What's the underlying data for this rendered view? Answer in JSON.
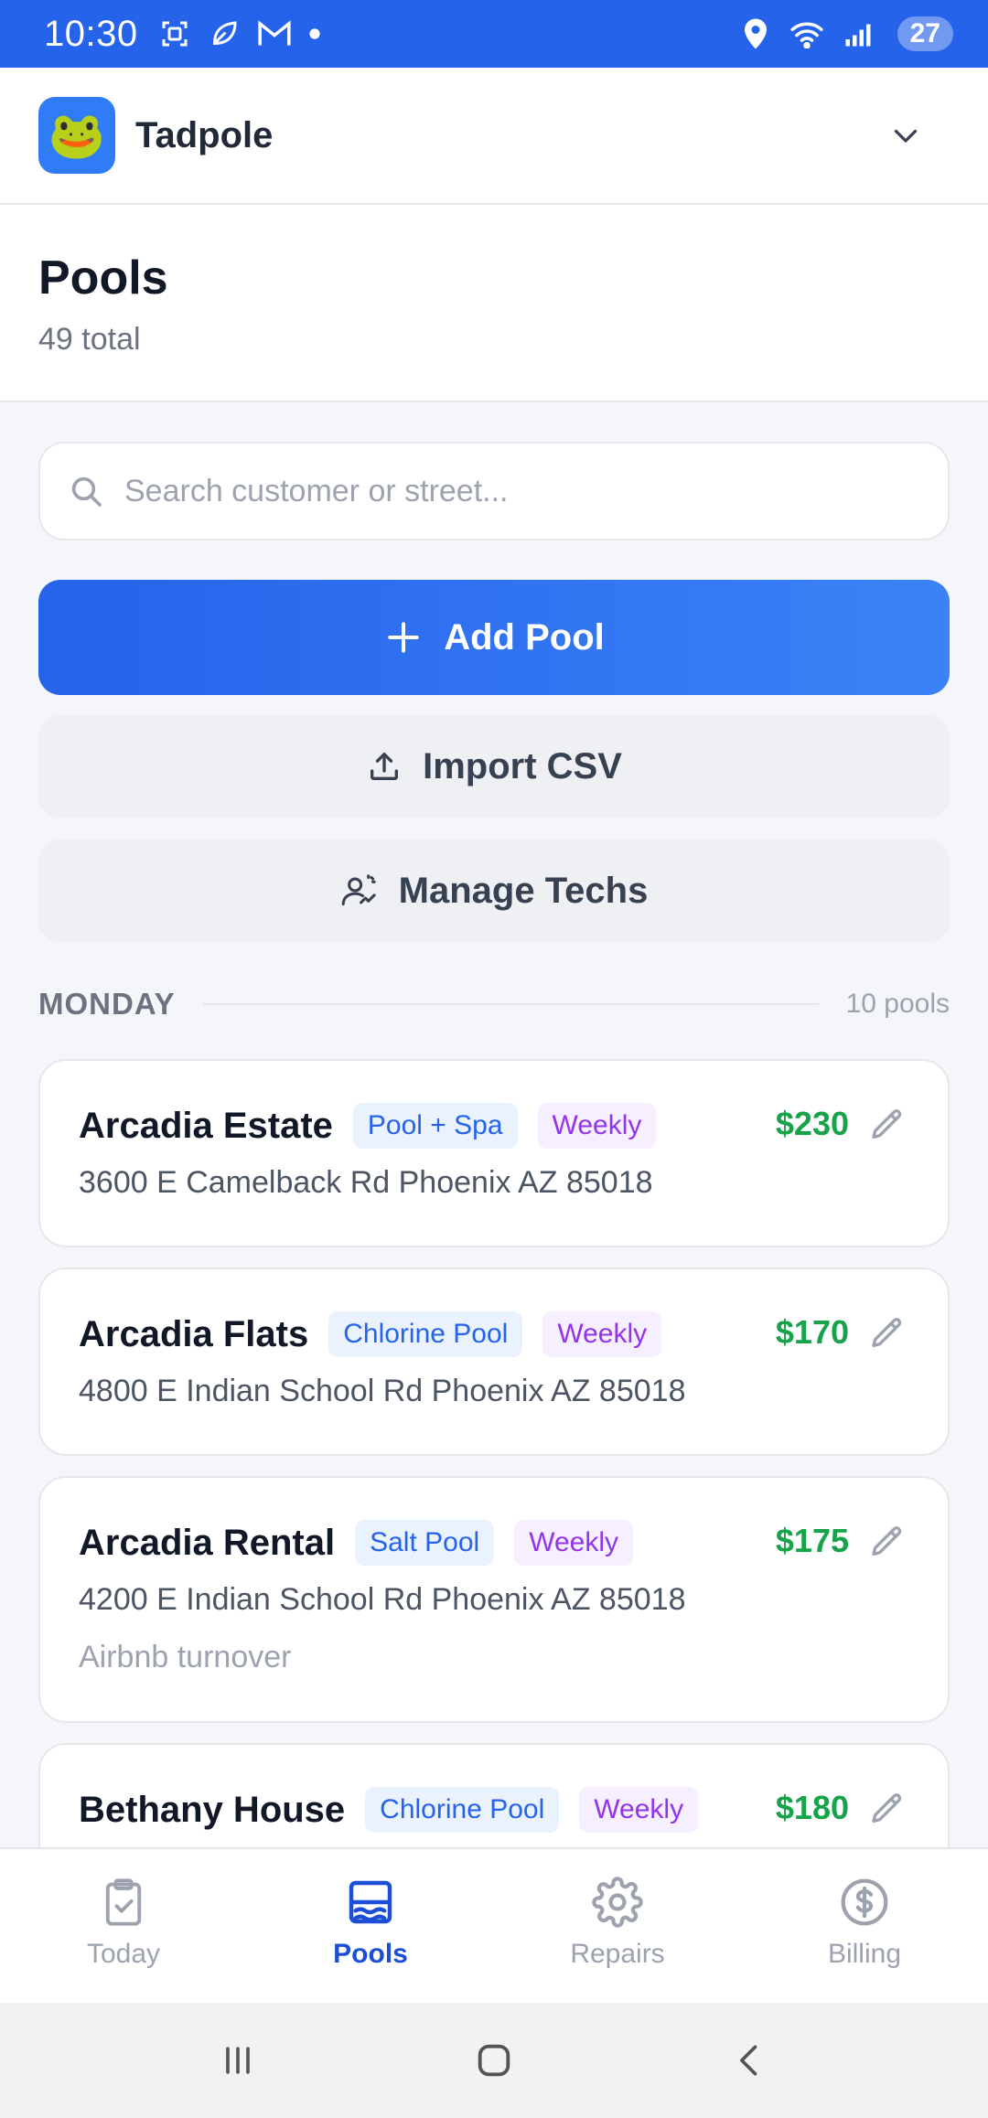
{
  "status_bar": {
    "time": "10:30",
    "battery": "27",
    "icons": [
      "screenshot-icon",
      "leaf-icon",
      "gmail-icon",
      "dot-icon",
      "location-icon",
      "wifi-icon",
      "signal-icon"
    ]
  },
  "app": {
    "name": "Tadpole",
    "logo_emoji": "🐸"
  },
  "page": {
    "title": "Pools",
    "subtitle": "49 total"
  },
  "search": {
    "placeholder": "Search customer or street...",
    "value": ""
  },
  "actions": {
    "add_pool": "Add Pool",
    "import_csv": "Import CSV",
    "manage_techs": "Manage Techs"
  },
  "section": {
    "day": "MONDAY",
    "count": "10 pools"
  },
  "pools": [
    {
      "name": "Arcadia Estate",
      "type": "Pool + Spa",
      "frequency": "Weekly",
      "price": "$230",
      "address": "3600 E Camelback Rd Phoenix AZ 85018",
      "note": ""
    },
    {
      "name": "Arcadia Flats",
      "type": "Chlorine Pool",
      "frequency": "Weekly",
      "price": "$170",
      "address": "4800 E Indian School Rd Phoenix AZ 85018",
      "note": ""
    },
    {
      "name": "Arcadia Rental",
      "type": "Salt Pool",
      "frequency": "Weekly",
      "price": "$175",
      "address": "4200 E Indian School Rd Phoenix AZ 85018",
      "note": "Airbnb turnover"
    },
    {
      "name": "Bethany House",
      "type": "Chlorine Pool",
      "frequency": "Weekly",
      "price": "$180",
      "address": "",
      "note": ""
    }
  ],
  "nav": {
    "items": [
      {
        "label": "Today",
        "icon": "clipboard-check-icon"
      },
      {
        "label": "Pools",
        "icon": "pool-icon"
      },
      {
        "label": "Repairs",
        "icon": "gear-icon"
      },
      {
        "label": "Billing",
        "icon": "dollar-icon"
      }
    ],
    "active": "Pools"
  },
  "colors": {
    "primary": "#2563eb",
    "price_green": "#16a34a",
    "tag_purple": "#9333ea"
  }
}
